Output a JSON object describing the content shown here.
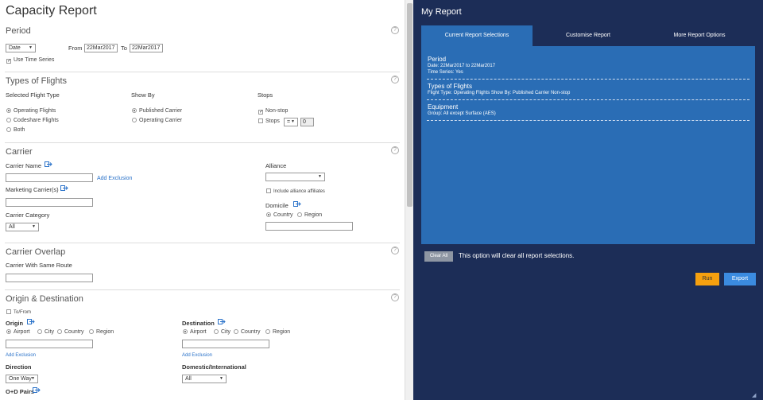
{
  "page_title": "Capacity Report",
  "period": {
    "title": "Period",
    "period_type": "Date",
    "from_label": "From",
    "from_value": "22Mar2017",
    "to_label": "To",
    "to_value": "22Mar2017",
    "use_time_series": "Use Time Series"
  },
  "types": {
    "title": "Types of Flights",
    "selected_label": "Selected Flight Type",
    "operating": "Operating Flights",
    "codeshare": "Codeshare Flights",
    "both": "Both",
    "showby_label": "Show By",
    "published": "Published Carrier",
    "operating_carrier": "Operating Carrier",
    "stops_label": "Stops",
    "nonstop": "Non-stop",
    "stops": "Stops",
    "stops_op": "=",
    "stops_value": "0"
  },
  "carrier": {
    "title": "Carrier",
    "name_label": "Carrier Name",
    "add_exclusion": "Add Exclusion",
    "marketing_label": "Marketing Carrier(s)",
    "category_label": "Carrier Category",
    "category_value": "All",
    "alliance_label": "Alliance",
    "include_affiliates": "Include alliance affiliates",
    "domicile_label": "Domicile",
    "country": "Country",
    "region": "Region"
  },
  "overlap": {
    "title": "Carrier Overlap",
    "same_route_label": "Carrier With Same Route"
  },
  "od": {
    "title": "Origin & Destination",
    "to_from": "To/From",
    "origin_label": "Origin",
    "destination_label": "Destination",
    "airport": "Airport",
    "city": "City",
    "country": "Country",
    "region": "Region",
    "add_exclusion": "Add Exclusion",
    "direction_label": "Direction",
    "direction_value": "One Way",
    "domint_label": "Domestic/International",
    "domint_value": "All",
    "od_pairs_label": "O+D Pairs"
  },
  "right": {
    "title": "My Report",
    "tabs": [
      "Current Report Selections",
      "Customise Report",
      "More Report Options"
    ],
    "summary": {
      "period_h": "Period",
      "period_l1": "Date: 22Mar2017  to 22Mar2017",
      "period_l2": "Time Series: Yes",
      "types_h": "Types of Flights",
      "types_l1": "Flight Type: Operating Flights    Show By: Published Carrier    Non-stop",
      "equip_h": "Equipment",
      "equip_l1": "Group: All except Surface (AES)"
    },
    "clear_all": "Clear All",
    "clear_note": "This option will clear all report selections.",
    "run": "Run",
    "export": "Export"
  },
  "colors": {
    "panel_bg": "#1c2d57",
    "active_tab": "#2a6db5",
    "run": "#f5a00f",
    "export": "#3b8be0"
  }
}
